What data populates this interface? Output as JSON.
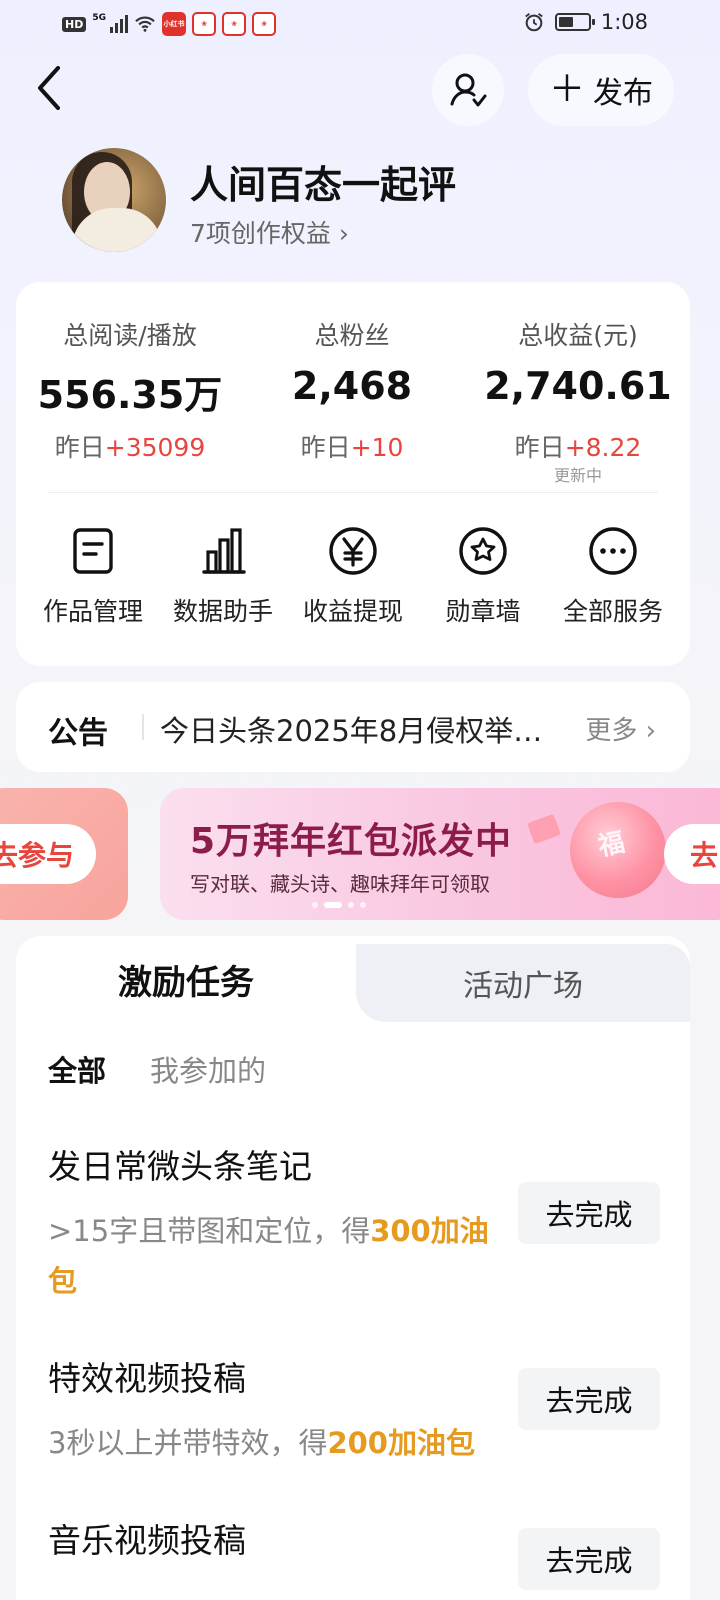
{
  "status_bar": {
    "hd": "HD",
    "network": "5G",
    "app_badges": [
      "小红书",
      "",
      "",
      ""
    ],
    "time": "1:08"
  },
  "header": {
    "publish_label": "发布"
  },
  "profile": {
    "name": "人间百态一起评",
    "benefits": "7项创作权益"
  },
  "stats": [
    {
      "label": "总阅读/播放",
      "value": "556.35万",
      "delta_prefix": "昨日",
      "delta": "+35099",
      "note": ""
    },
    {
      "label": "总粉丝",
      "value": "2,468",
      "delta_prefix": "昨日",
      "delta": "+10",
      "note": ""
    },
    {
      "label": "总收益(元)",
      "value": "2,740.61",
      "delta_prefix": "昨日",
      "delta": "+8.22",
      "note": "更新中"
    }
  ],
  "services": [
    {
      "label": "作品管理",
      "icon": "document-icon"
    },
    {
      "label": "数据助手",
      "icon": "bar-chart-icon"
    },
    {
      "label": "收益提现",
      "icon": "yen-icon"
    },
    {
      "label": "勋章墙",
      "icon": "badge-icon"
    },
    {
      "label": "全部服务",
      "icon": "more-icon"
    }
  ],
  "notice": {
    "tag": "公告",
    "text": "今日头条2025年8月侵权举报…",
    "more": "更多"
  },
  "banner": {
    "left_button": "去参与",
    "title": "5万拜年红包派发中",
    "subtitle": "写对联、藏头诗、趣味拜年可领取",
    "lantern_char": "福",
    "right_button": "去",
    "dot_count": 4,
    "active_dot": 1
  },
  "tasks": {
    "tabs": [
      "激励任务",
      "活动广场"
    ],
    "active_tab": 0,
    "filters": [
      "全部",
      "我参加的"
    ],
    "items": [
      {
        "title": "发日常微头条笔记",
        "desc": ">15字且带图和定位，得",
        "reward": "300加油包",
        "action": "去完成"
      },
      {
        "title": "特效视频投稿",
        "desc": "3秒以上并带特效，得",
        "reward": "200加油包",
        "action": "去完成"
      },
      {
        "title": "音乐视频投稿",
        "desc": "",
        "reward": "",
        "action": "去完成"
      }
    ]
  },
  "colors": {
    "accent_red": "#e8453c",
    "reward_orange": "#e49b1f",
    "banner_title": "#8c1d4b"
  }
}
